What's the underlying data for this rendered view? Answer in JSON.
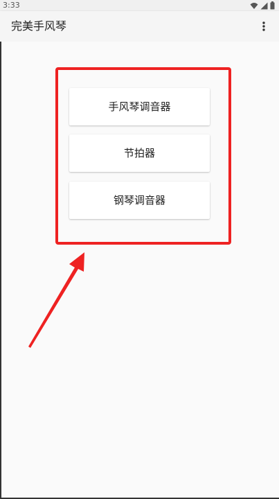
{
  "status_bar": {
    "time": "3:33",
    "icons": [
      "wifi-icon",
      "signal-icon",
      "battery-icon"
    ]
  },
  "app_bar": {
    "title": "完美手风琴",
    "menu_icon": "more-vert-icon"
  },
  "menu": {
    "buttons": [
      {
        "label": "手风琴调音器"
      },
      {
        "label": "节拍器"
      },
      {
        "label": "钢琴调音器"
      }
    ]
  },
  "annotation": {
    "color": "#ee2222"
  }
}
